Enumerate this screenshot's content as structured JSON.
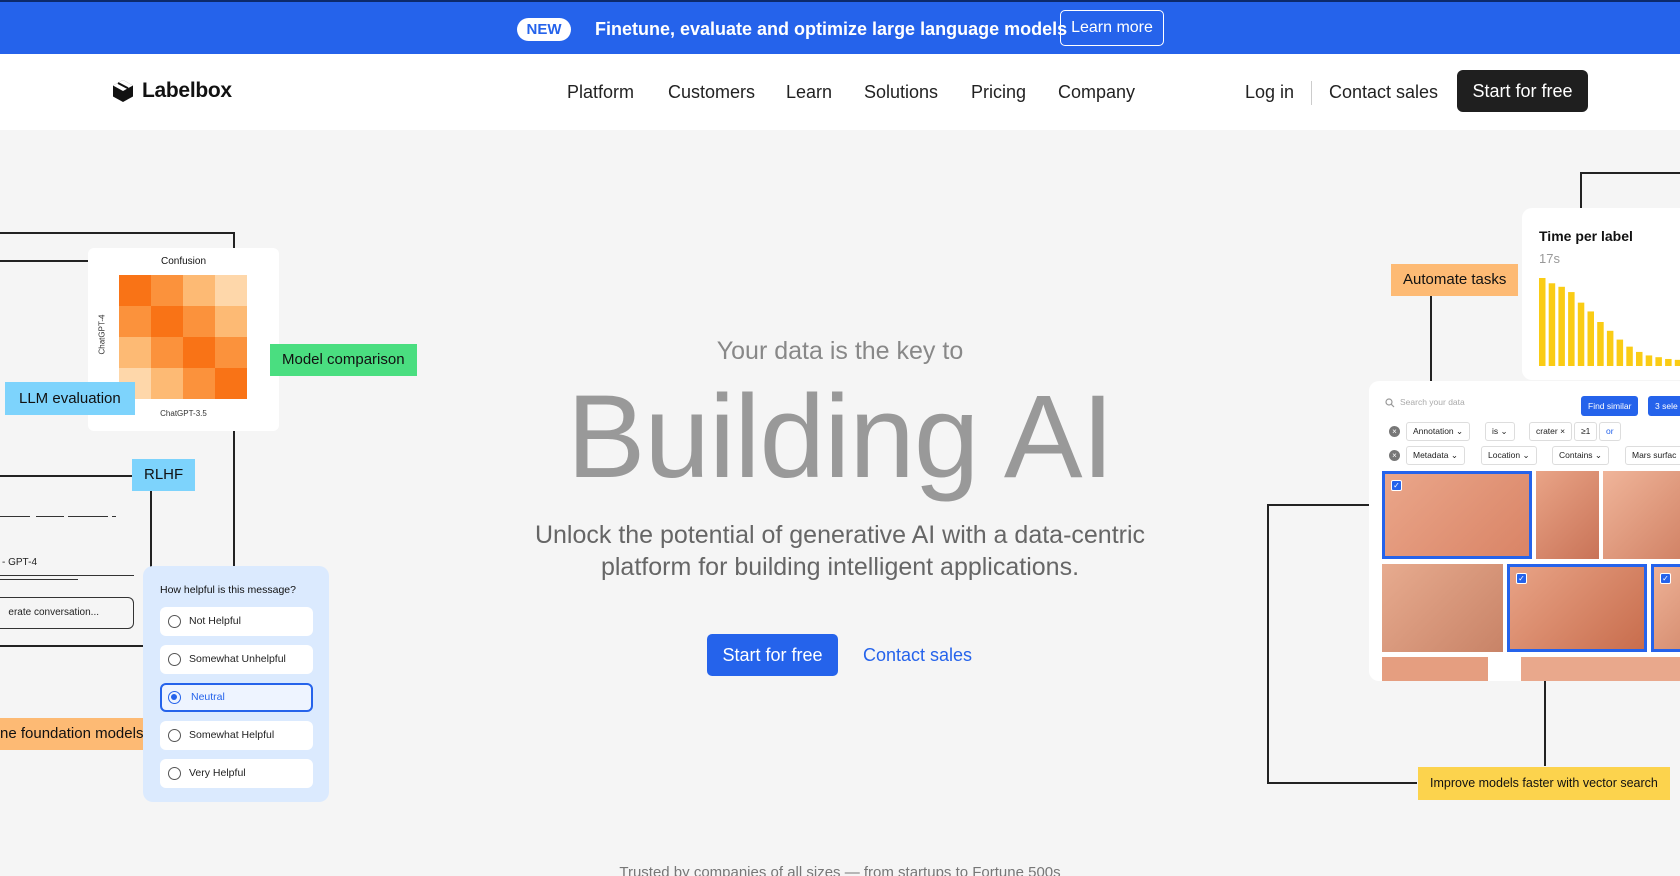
{
  "announcement": {
    "badge": "NEW",
    "message": "Finetune, evaluate and optimize large language models",
    "cta": "Learn more"
  },
  "nav": {
    "brand": "Labelbox",
    "links": [
      "Platform",
      "Customers",
      "Learn",
      "Solutions",
      "Pricing",
      "Company"
    ],
    "login": "Log in",
    "contact": "Contact sales",
    "cta": "Start for free"
  },
  "hero": {
    "subtitle": "Your data is the key to",
    "title": "Building AI",
    "description": "Unlock the potential of generative AI with a data-centric platform for building intelligent applications.",
    "cta_primary": "Start for free",
    "cta_secondary": "Contact sales",
    "trusted": "Trusted by companies of all sizes — from startups to Fortune 500s"
  },
  "left_visual": {
    "confusion": {
      "title": "Confusion",
      "x_label": "ChatGPT-3.5",
      "y_label": "ChatGPT-4",
      "cells": [
        "#f97316",
        "#fb923c",
        "#fdba74",
        "#fed7aa",
        "#fb923c",
        "#f97316",
        "#fb923c",
        "#fdba74",
        "#fdba74",
        "#fb923c",
        "#f97316",
        "#fb923c",
        "#fed7aa",
        "#fdba74",
        "#fb923c",
        "#f97316"
      ]
    },
    "tags": {
      "llm_evaluation": "LLM evaluation",
      "model_comparison": "Model comparison",
      "rlhf": "RLHF",
      "foundation_models": "ne foundation models"
    },
    "gpt4_label": "- GPT-4",
    "chat_pill": "erate conversation...",
    "survey": {
      "question": "How helpful is this message?",
      "options": [
        "Not Helpful",
        "Somewhat Unhelpful",
        "Neutral",
        "Somewhat Helpful",
        "Very Helpful"
      ],
      "selected": "Neutral"
    }
  },
  "right_visual": {
    "time_per_label": {
      "title": "Time per label",
      "value": "17s",
      "bars": [
        1.0,
        0.94,
        0.9,
        0.84,
        0.72,
        0.62,
        0.5,
        0.4,
        0.3,
        0.22,
        0.16,
        0.12,
        0.1,
        0.08,
        0.07
      ],
      "bar_color": "#facc15"
    },
    "search": {
      "placeholder": "Search your data",
      "find_similar": "Find similar",
      "selected": "3 sele",
      "row1": [
        "Annotation",
        "is",
        "crater",
        "≥1",
        "or"
      ],
      "row2": [
        "Metadata",
        "Location",
        "Contains",
        "Mars surfac"
      ]
    },
    "tags": {
      "automate": "Automate tasks",
      "vector_search": "Improve models faster with vector search"
    }
  }
}
